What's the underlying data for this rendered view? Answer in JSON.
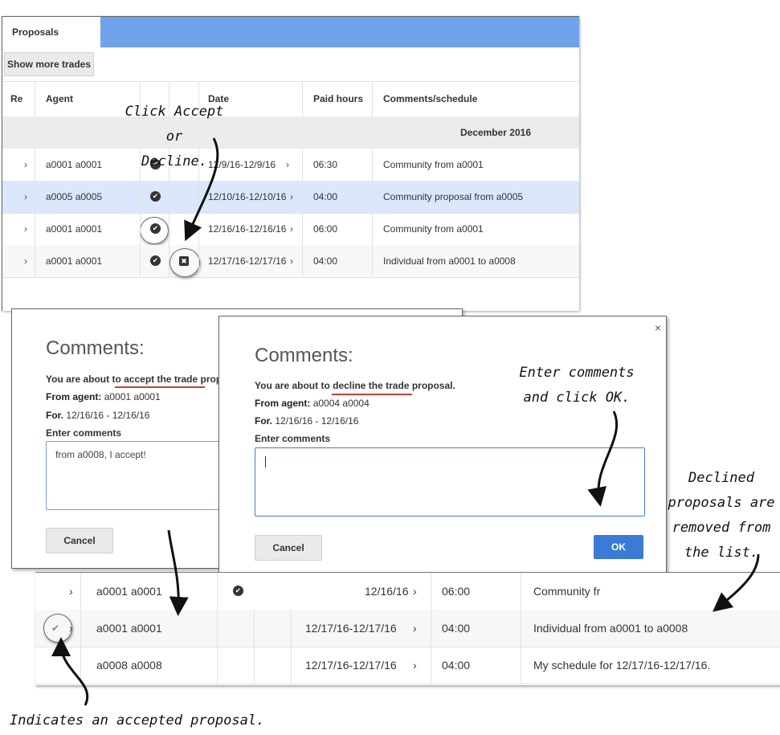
{
  "top_panel": {
    "tab_label": "Proposals",
    "show_more_label": "Show more trades",
    "columns": {
      "re": "Re",
      "agent": "Agent",
      "date": "Date",
      "paid_hours": "Paid hours",
      "comments": "Comments/schedule"
    },
    "month_label": "December 2016",
    "rows": [
      {
        "agent": "a0001 a0001",
        "date": "12/9/16-12/9/16",
        "hours": "06:30",
        "comment": "Community from a0001"
      },
      {
        "agent": "a0005 a0005",
        "date": "12/10/16-12/10/16",
        "hours": "04:00",
        "comment": "Community proposal from a0005"
      },
      {
        "agent": "a0001 a0001",
        "date": "12/16/16-12/16/16",
        "hours": "06:00",
        "comment": "Community from a0001"
      },
      {
        "agent": "a0001 a0001",
        "date": "12/17/16-12/17/16",
        "hours": "04:00",
        "comment": "Individual from a0001 to a0008"
      }
    ]
  },
  "accept_dialog": {
    "title": "Comments:",
    "message_prefix": "You are about to ",
    "message_action": "accept the trade proposa",
    "from_label": "From agent:",
    "from_value": "a0001 a0001",
    "for_label": "For.",
    "for_value": "12/16/16 - 12/16/16",
    "enter_label": "Enter comments",
    "comment_value": "from a0008, I accept!",
    "cancel_label": "Cancel"
  },
  "decline_dialog": {
    "title": "Comments:",
    "message_prefix": "You are about to ",
    "message_action": "decline the trade proposal.",
    "from_label": "From agent:",
    "from_value": "a0004 a0004",
    "for_label": "For.",
    "for_value": "12/16/16 - 12/16/16",
    "enter_label": "Enter comments",
    "cancel_label": "Cancel",
    "ok_label": "OK",
    "close_glyph": "×"
  },
  "bottom_panel": {
    "rows": [
      {
        "agent": "a0001 a0001",
        "date": "12/16/16",
        "hours": "06:00",
        "comment": "Community fr"
      },
      {
        "agent": "a0001 a0001",
        "date": "12/17/16-12/17/16",
        "hours": "04:00",
        "comment": "Individual from a0001 to a0008"
      },
      {
        "agent": "a0008 a0008",
        "date": "12/17/16-12/17/16",
        "hours": "04:00",
        "comment": "My schedule for 12/17/16-12/17/16."
      }
    ]
  },
  "annotations": {
    "click_accept": [
      "Click Accept or",
      "Decline."
    ],
    "enter_comments": [
      "Enter comments",
      "and click OK."
    ],
    "declined": [
      "Declined",
      "proposals are",
      "removed from",
      "the list."
    ],
    "accepted": "Indicates an accepted proposal."
  },
  "icons": {
    "chevron": "›",
    "check": "✔",
    "decline": "✖"
  },
  "colors": {
    "tab_strip": "#6fa4ec",
    "selected_row": "#dbe8fb",
    "ok_button": "#3a7bd5",
    "highlight_underline": "#d23a3a"
  }
}
